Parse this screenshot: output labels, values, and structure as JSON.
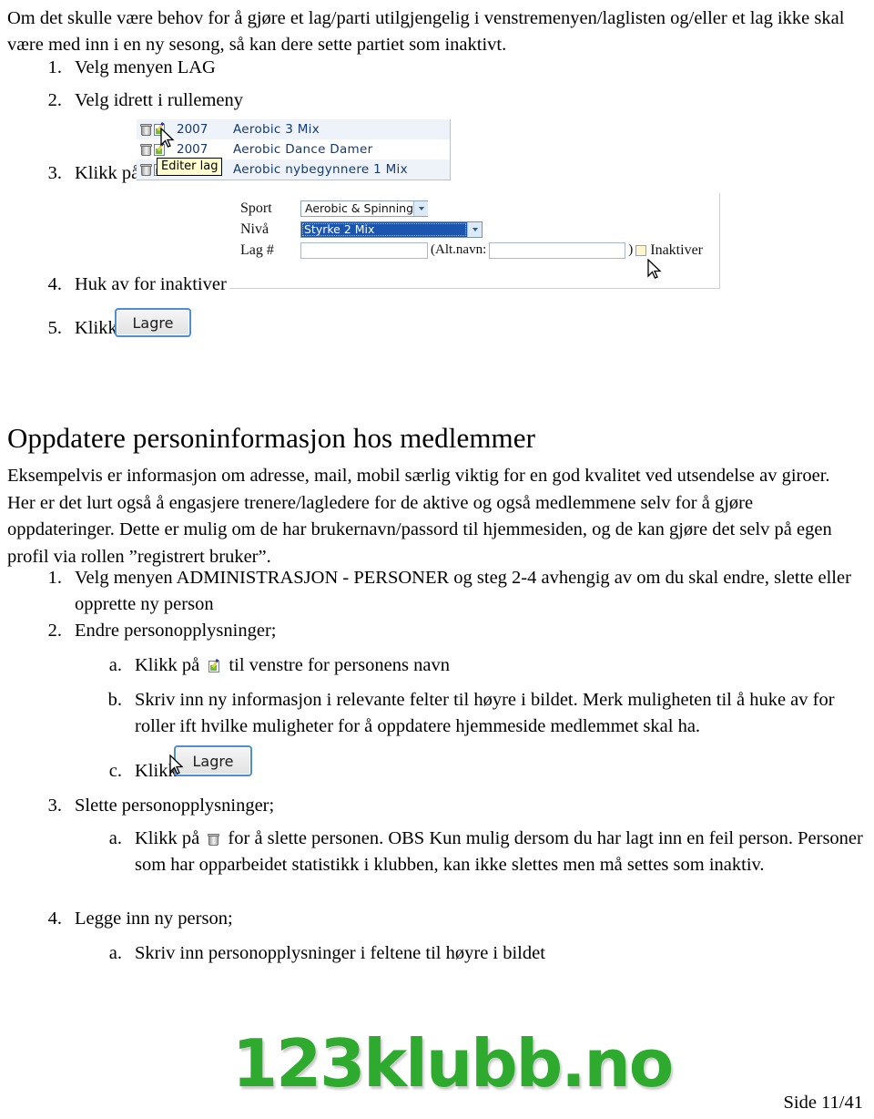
{
  "document": {
    "intro_paragraph": "Om det skulle være behov for å gjøre et lag/parti utilgjengelig i venstremenyen/laglisten og/eller et lag ikke skal være med inn i en ny sesong, så kan dere sette partiet som inaktivt.",
    "steps_part1": [
      {
        "num": "1.",
        "text": "Velg menyen LAG"
      },
      {
        "num": "2.",
        "text": "Velg idrett i rullemeny"
      },
      {
        "num": "3.",
        "text": "Klikk på"
      },
      {
        "num": "4.",
        "text": "Huk av for inaktiver"
      },
      {
        "num": "5.",
        "text": "Klikk"
      }
    ],
    "section_heading": "Oppdatere personinformasjon hos medlemmer",
    "section_paragraph": "Eksempelvis er informasjon om adresse, mail, mobil særlig viktig for en god kvalitet ved utsendelse av giroer. Her er det lurt også å engasjere trenere/lagledere for de aktive og også medlemmene selv for å gjøre oppdateringer. Dette er mulig om de har brukernavn/passord til hjemmesiden, og de kan gjøre det selv på egen profil via rollen ”registrert bruker”.",
    "steps_part2": [
      {
        "num": "1.",
        "text": "Velg menyen ADMINISTRASJON - PERSONER og steg 2-4 avhengig av om du skal endre, slette eller opprette ny person"
      },
      {
        "num": "2.",
        "text": "Endre personopplysninger;"
      },
      {
        "num": "a.",
        "text_before": "Klikk på",
        "text_after": "til venstre for personens navn",
        "icon": "edit-icon"
      },
      {
        "num": "b.",
        "text": "Skriv inn ny informasjon i relevante felter til høyre i bildet. Merk muligheten til å huke av for roller ift hvilke muligheter for å oppdatere hjemmeside medlemmet skal ha."
      },
      {
        "num": "c.",
        "text": "Klikk"
      },
      {
        "num": "3.",
        "text": "Slette personopplysninger;"
      },
      {
        "num": "a.",
        "text_before": "Klikk på",
        "text_after": "for å slette personen. OBS Kun mulig dersom du har lagt inn en feil person. Personer som har opparbeidet statistikk i klubben, kan ikke slettes men må settes som inaktiv.",
        "icon": "trash-icon"
      },
      {
        "num": "4.",
        "text": "Legge inn ny person;"
      },
      {
        "num": "a.",
        "text": "Skriv inn personopplysninger i feltene til høyre i bildet"
      }
    ],
    "footer_page": "Side 11/41",
    "logo_text": "123klubb.no",
    "logo_color": "#2eab2e"
  },
  "screenshot_teamlist": {
    "tooltip": "Editer lag",
    "rows": [
      {
        "year": "2007",
        "name": "Aerobic 3 Mix"
      },
      {
        "year": "2007",
        "name": "Aerobic Dance Damer"
      },
      {
        "year": "",
        "name": "Aerobic nybegynnere 1 Mix"
      }
    ],
    "row_icons": [
      "trash-icon",
      "edit-icon"
    ]
  },
  "screenshot_form": {
    "fields": [
      {
        "label": "Sport",
        "type": "select",
        "value": "Aerobic & Spinning",
        "selected": false
      },
      {
        "label": "Nivå",
        "type": "select",
        "value": "Styrke 2 Mix",
        "selected": true
      },
      {
        "label": "Lag #",
        "type": "text",
        "value": ""
      }
    ],
    "alt_name_label": "(Alt.navn:",
    "alt_name_close": ")",
    "alt_name_value": "",
    "checkbox_label": "Inaktiver",
    "checkbox_checked": false,
    "checkbox_color": "#fdf6cd",
    "highlight_color": "#1b55b0"
  },
  "buttons": {
    "save_label": "Lagre"
  }
}
